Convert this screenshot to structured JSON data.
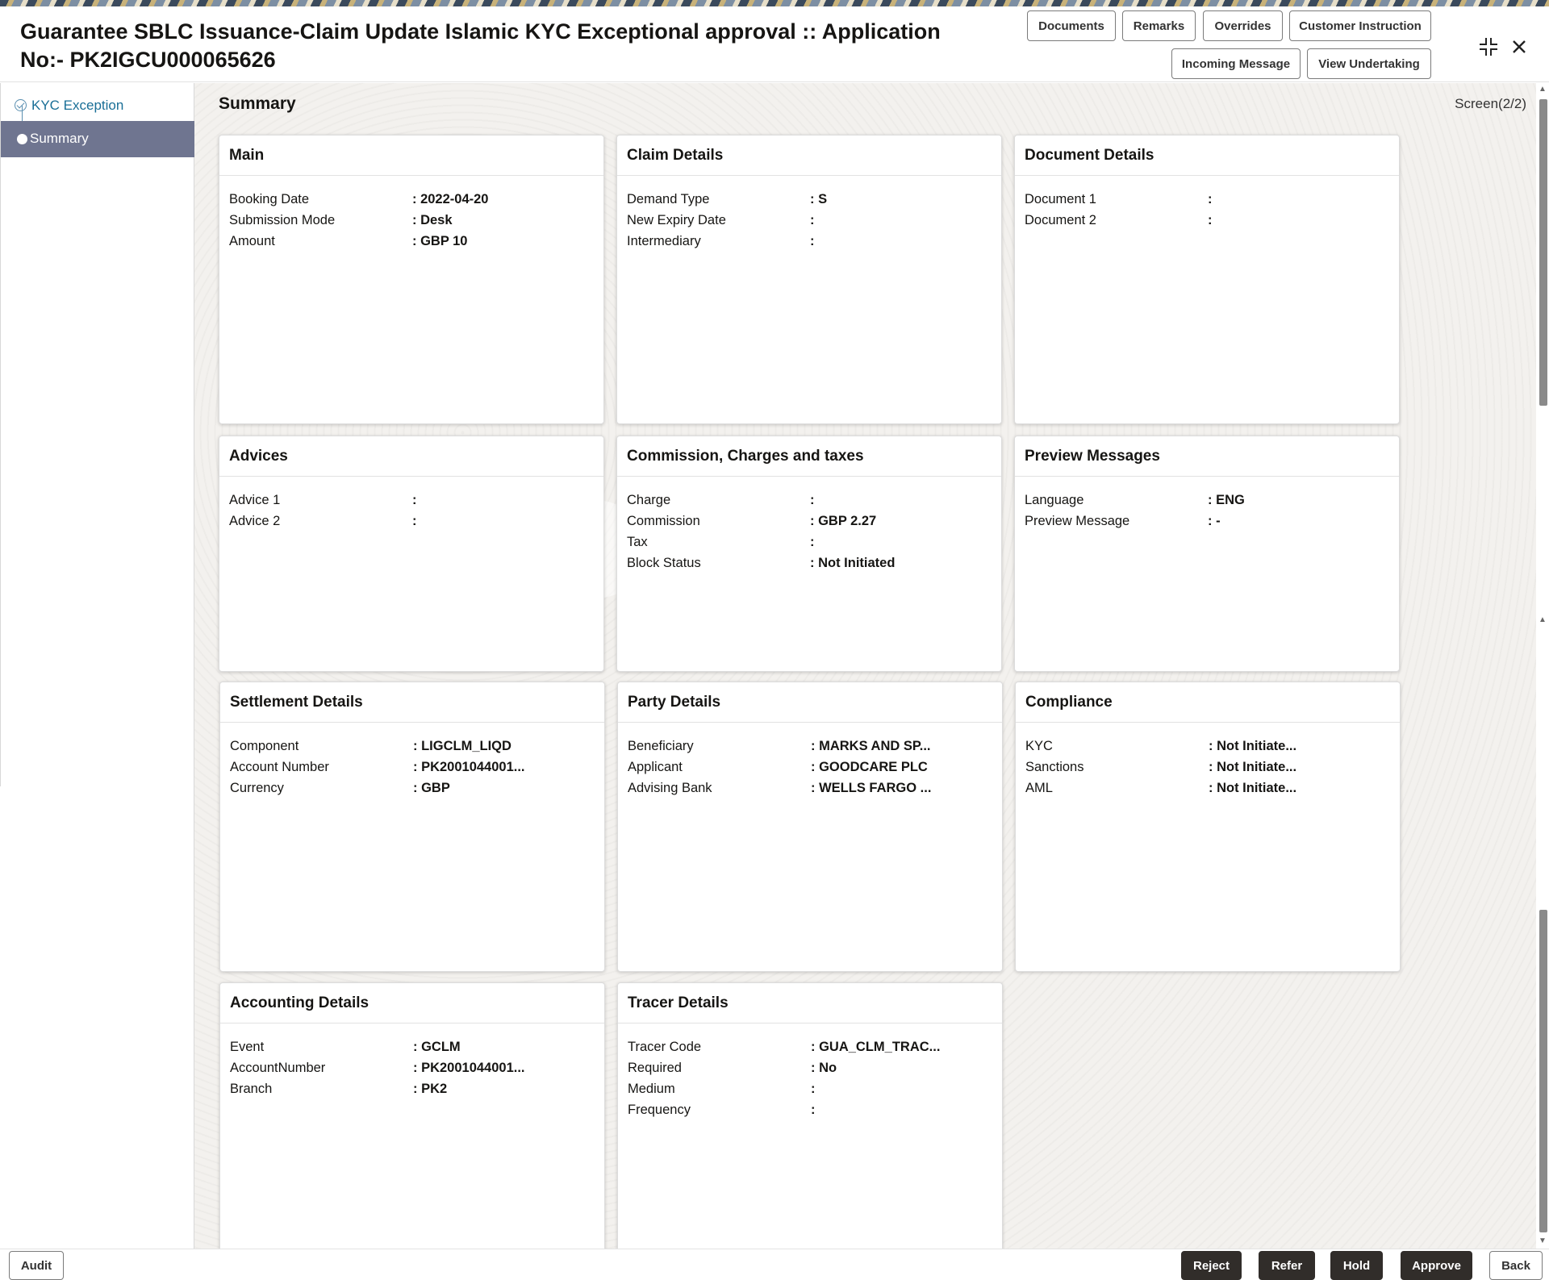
{
  "header": {
    "title": "Guarantee SBLC Issuance-Claim Update Islamic KYC Exceptional approval :: Application No:- PK2IGCU000065626",
    "buttons": {
      "documents": "Documents",
      "remarks": "Remarks",
      "overrides": "Overrides",
      "customer_instruction": "Customer Instruction",
      "incoming_message": "Incoming Message",
      "view_undertaking": "View Undertaking"
    },
    "icons": {
      "minimize": "collapse-icon",
      "close": "close-icon"
    }
  },
  "sidebar": {
    "items": [
      {
        "label": "KYC Exception",
        "state": "done"
      },
      {
        "label": "Summary",
        "state": "active"
      }
    ]
  },
  "content": {
    "title": "Summary",
    "screen": "Screen(2/2)"
  },
  "cards": {
    "main": {
      "title": "Main",
      "rows": [
        {
          "k": "Booking Date",
          "v": ": 2022-04-20"
        },
        {
          "k": "Submission Mode",
          "v": ": Desk"
        },
        {
          "k": "Amount",
          "v": ": GBP 10"
        }
      ]
    },
    "claim": {
      "title": "Claim Details",
      "rows": [
        {
          "k": "Demand Type",
          "v": ": S"
        },
        {
          "k": "New Expiry Date",
          "v": ":"
        },
        {
          "k": "Intermediary",
          "v": ":"
        }
      ]
    },
    "document": {
      "title": "Document Details",
      "rows": [
        {
          "k": "Document 1",
          "v": ":"
        },
        {
          "k": "Document 2",
          "v": ":"
        }
      ]
    },
    "advices": {
      "title": "Advices",
      "rows": [
        {
          "k": "Advice 1",
          "v": ":"
        },
        {
          "k": "Advice 2",
          "v": ":"
        }
      ]
    },
    "commission": {
      "title": "Commission, Charges and taxes",
      "rows": [
        {
          "k": "Charge",
          "v": ":"
        },
        {
          "k": "Commission",
          "v": ": GBP  2.27"
        },
        {
          "k": "Tax",
          "v": ":"
        },
        {
          "k": "Block Status",
          "v": ": Not Initiated"
        }
      ]
    },
    "preview": {
      "title": "Preview Messages",
      "rows": [
        {
          "k": "Language",
          "v": ": ENG"
        },
        {
          "k": "Preview Message",
          "v": ": -"
        }
      ]
    },
    "settlement": {
      "title": "Settlement Details",
      "rows": [
        {
          "k": "Component",
          "v": ": LIGCLM_LIQD"
        },
        {
          "k": "Account Number",
          "v": ": PK2001044001..."
        },
        {
          "k": "Currency",
          "v": ": GBP"
        }
      ]
    },
    "party": {
      "title": "Party Details",
      "rows": [
        {
          "k": "Beneficiary",
          "v": ": MARKS AND SP..."
        },
        {
          "k": "Applicant",
          "v": ": GOODCARE PLC"
        },
        {
          "k": "Advising Bank",
          "v": ": WELLS FARGO ..."
        }
      ]
    },
    "compliance": {
      "title": "Compliance",
      "rows": [
        {
          "k": "KYC",
          "v": ": Not Initiate..."
        },
        {
          "k": "Sanctions",
          "v": ": Not Initiate..."
        },
        {
          "k": "AML",
          "v": ": Not Initiate..."
        }
      ]
    },
    "accounting": {
      "title": "Accounting Details",
      "rows": [
        {
          "k": "Event",
          "v": ": GCLM"
        },
        {
          "k": "AccountNumber",
          "v": ": PK2001044001..."
        },
        {
          "k": "Branch",
          "v": ": PK2"
        }
      ]
    },
    "tracer": {
      "title": "Tracer Details",
      "rows": [
        {
          "k": "Tracer Code",
          "v": ": GUA_CLM_TRAC..."
        },
        {
          "k": "Required",
          "v": ": No"
        },
        {
          "k": "Medium",
          "v": ":"
        },
        {
          "k": "Frequency",
          "v": ":"
        }
      ]
    }
  },
  "footer": {
    "audit": "Audit",
    "reject": "Reject",
    "refer": "Refer",
    "hold": "Hold",
    "approve": "Approve",
    "back": "Back"
  }
}
